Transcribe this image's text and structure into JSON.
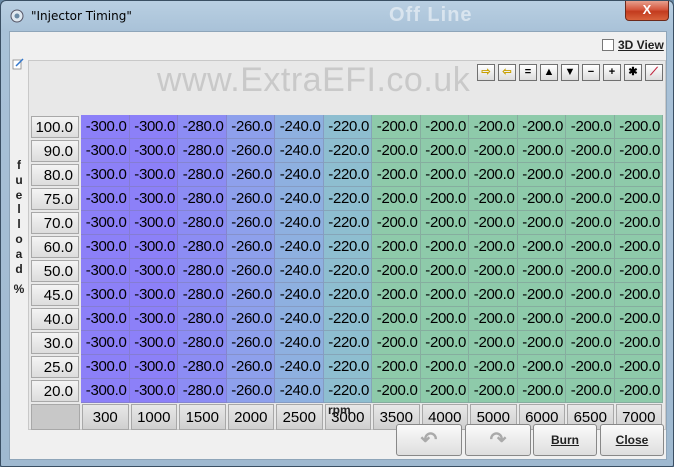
{
  "window": {
    "title": "\"Injector Timing\"",
    "offline_watermark": "Off Line",
    "close_symbol": "X"
  },
  "view3d": {
    "label": "3D View",
    "checked": false
  },
  "table": {
    "watermark": "www.ExtraEFI.co.uk",
    "y_axis_label": [
      "f",
      "u",
      "e",
      "l",
      "l",
      "o",
      "a",
      "d",
      "%"
    ],
    "x_axis_label": "rpm",
    "row_headers": [
      "100.0",
      "90.0",
      "80.0",
      "75.0",
      "70.0",
      "60.0",
      "50.0",
      "45.0",
      "40.0",
      "30.0",
      "25.0",
      "20.0"
    ],
    "col_headers": [
      "300",
      "1000",
      "1500",
      "2000",
      "2500",
      "3000",
      "3500",
      "4000",
      "5000",
      "6000",
      "6500",
      "7000"
    ],
    "row_values": [
      "-300.0",
      "-300.0",
      "-280.0",
      "-260.0",
      "-240.0",
      "-220.0",
      "-200.0",
      "-200.0",
      "-200.0",
      "-200.0",
      "-200.0",
      "-200.0"
    ],
    "col_colors": [
      "#8c80f8",
      "#8c80f8",
      "#8c8cf4",
      "#8ea0ec",
      "#8eb0e0",
      "#8ebed0",
      "#8ecaaa",
      "#8ecaaa",
      "#8ecaaa",
      "#8ecaaa",
      "#8ecaaa",
      "#8ecaaa"
    ]
  },
  "toolbar": {
    "buttons": [
      {
        "name": "shift-right",
        "glyph": "⇨"
      },
      {
        "name": "shift-left",
        "glyph": "⇦"
      },
      {
        "name": "set-equal",
        "glyph": "="
      },
      {
        "name": "increase",
        "glyph": "▲"
      },
      {
        "name": "decrease",
        "glyph": "▼"
      },
      {
        "name": "subtract",
        "glyph": "−"
      },
      {
        "name": "add",
        "glyph": "+"
      },
      {
        "name": "multiply",
        "glyph": "✱"
      },
      {
        "name": "interpolate",
        "glyph": "⟋"
      }
    ]
  },
  "buttons": {
    "undo_glyph": "↶",
    "redo_glyph": "↷",
    "burn_label": "Burn",
    "close_label": "Close"
  }
}
